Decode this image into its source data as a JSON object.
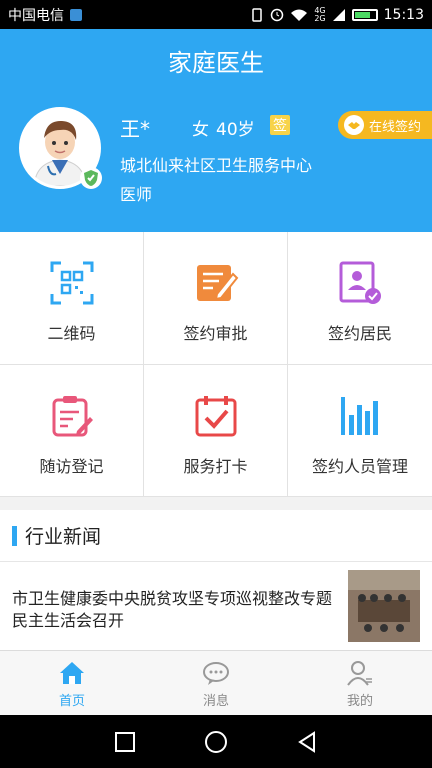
{
  "status_bar": {
    "carrier": "中国电信",
    "network_labels": [
      "4G",
      "2G"
    ],
    "time": "15:13"
  },
  "header": {
    "title": "家庭医生",
    "doctor": {
      "name": "王*",
      "gender": "女",
      "age": "40岁",
      "sign_badge": "签",
      "organization": "城北仙来社区卫生服务中心",
      "job_title": "医师"
    },
    "online_sign_label": "在线签约"
  },
  "menu": {
    "items": [
      {
        "label": "二维码",
        "icon": "qrcode-icon",
        "color": "#2ea7f2"
      },
      {
        "label": "签约审批",
        "icon": "edit-document-icon",
        "color": "#f08a3c"
      },
      {
        "label": "签约居民",
        "icon": "resident-card-icon",
        "color": "#b45cd9"
      },
      {
        "label": "随访登记",
        "icon": "clipboard-icon",
        "color": "#e8577a"
      },
      {
        "label": "服务打卡",
        "icon": "calendar-check-icon",
        "color": "#e84848"
      },
      {
        "label": "签约人员管理",
        "icon": "bar-chart-icon",
        "color": "#2ea7f2"
      }
    ]
  },
  "news": {
    "section_title": "行业新闻",
    "items": [
      {
        "title": "市卫生健康委中央脱贫攻坚专项巡视整改专题民主生活会召开"
      }
    ]
  },
  "tab_bar": {
    "tabs": [
      {
        "label": "首页",
        "icon": "home-icon",
        "active": true
      },
      {
        "label": "消息",
        "icon": "chat-bubbles-icon",
        "active": false
      },
      {
        "label": "我的",
        "icon": "person-icon",
        "active": false
      }
    ]
  },
  "colors": {
    "primary": "#2ea7f2",
    "accent_badge": "#f5b820"
  }
}
